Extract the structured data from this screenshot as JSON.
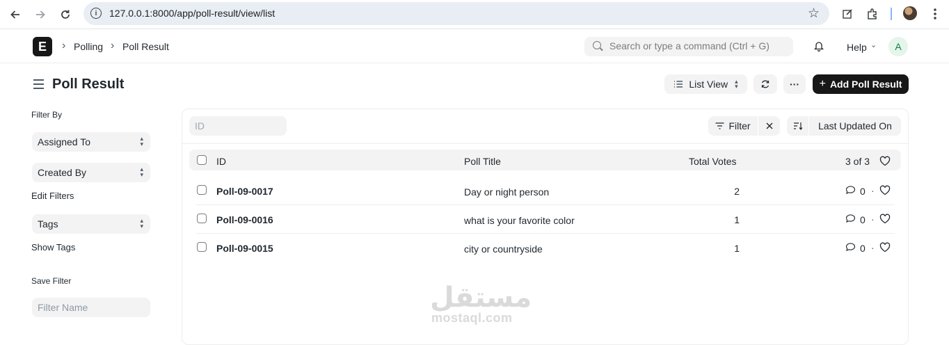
{
  "browser": {
    "url": "127.0.0.1:8000/app/poll-result/view/list",
    "icons": [
      "back-icon",
      "forward-icon",
      "reload-icon",
      "site-info-icon",
      "bookmark-star-icon",
      "edit-icon",
      "extensions-icon",
      "profile-avatar",
      "menu-icon"
    ]
  },
  "navbar": {
    "logo_letter": "E",
    "breadcrumbs": [
      "Polling",
      "Poll Result"
    ],
    "search_placeholder": "Search or type a command (Ctrl + G)",
    "help_label": "Help",
    "avatar_letter": "A"
  },
  "page": {
    "title": "Poll Result",
    "view_label": "List View",
    "more_label": "···",
    "add_label": "Add Poll Result"
  },
  "sidebar": {
    "filter_by_label": "Filter By",
    "selects": [
      "Assigned To",
      "Created By",
      "Tags"
    ],
    "edit_filters_label": "Edit Filters",
    "show_tags_label": "Show Tags",
    "save_filter_label": "Save Filter",
    "filter_name_placeholder": "Filter Name"
  },
  "list": {
    "id_placeholder": "ID",
    "filter_label": "Filter",
    "sort_label": "Last Updated On",
    "columns": {
      "id": "ID",
      "title": "Poll Title",
      "votes": "Total Votes",
      "count": "3 of 3"
    },
    "rows": [
      {
        "id": "Poll-09-0017",
        "title": "Day or night person",
        "votes": "2",
        "comments": "0"
      },
      {
        "id": "Poll-09-0016",
        "title": "what is your favorite color",
        "votes": "1",
        "comments": "0"
      },
      {
        "id": "Poll-09-0015",
        "title": "city or countryside",
        "votes": "1",
        "comments": "0"
      }
    ]
  },
  "watermark": {
    "arabic": "مستقل",
    "latin": "mostaql.com"
  }
}
